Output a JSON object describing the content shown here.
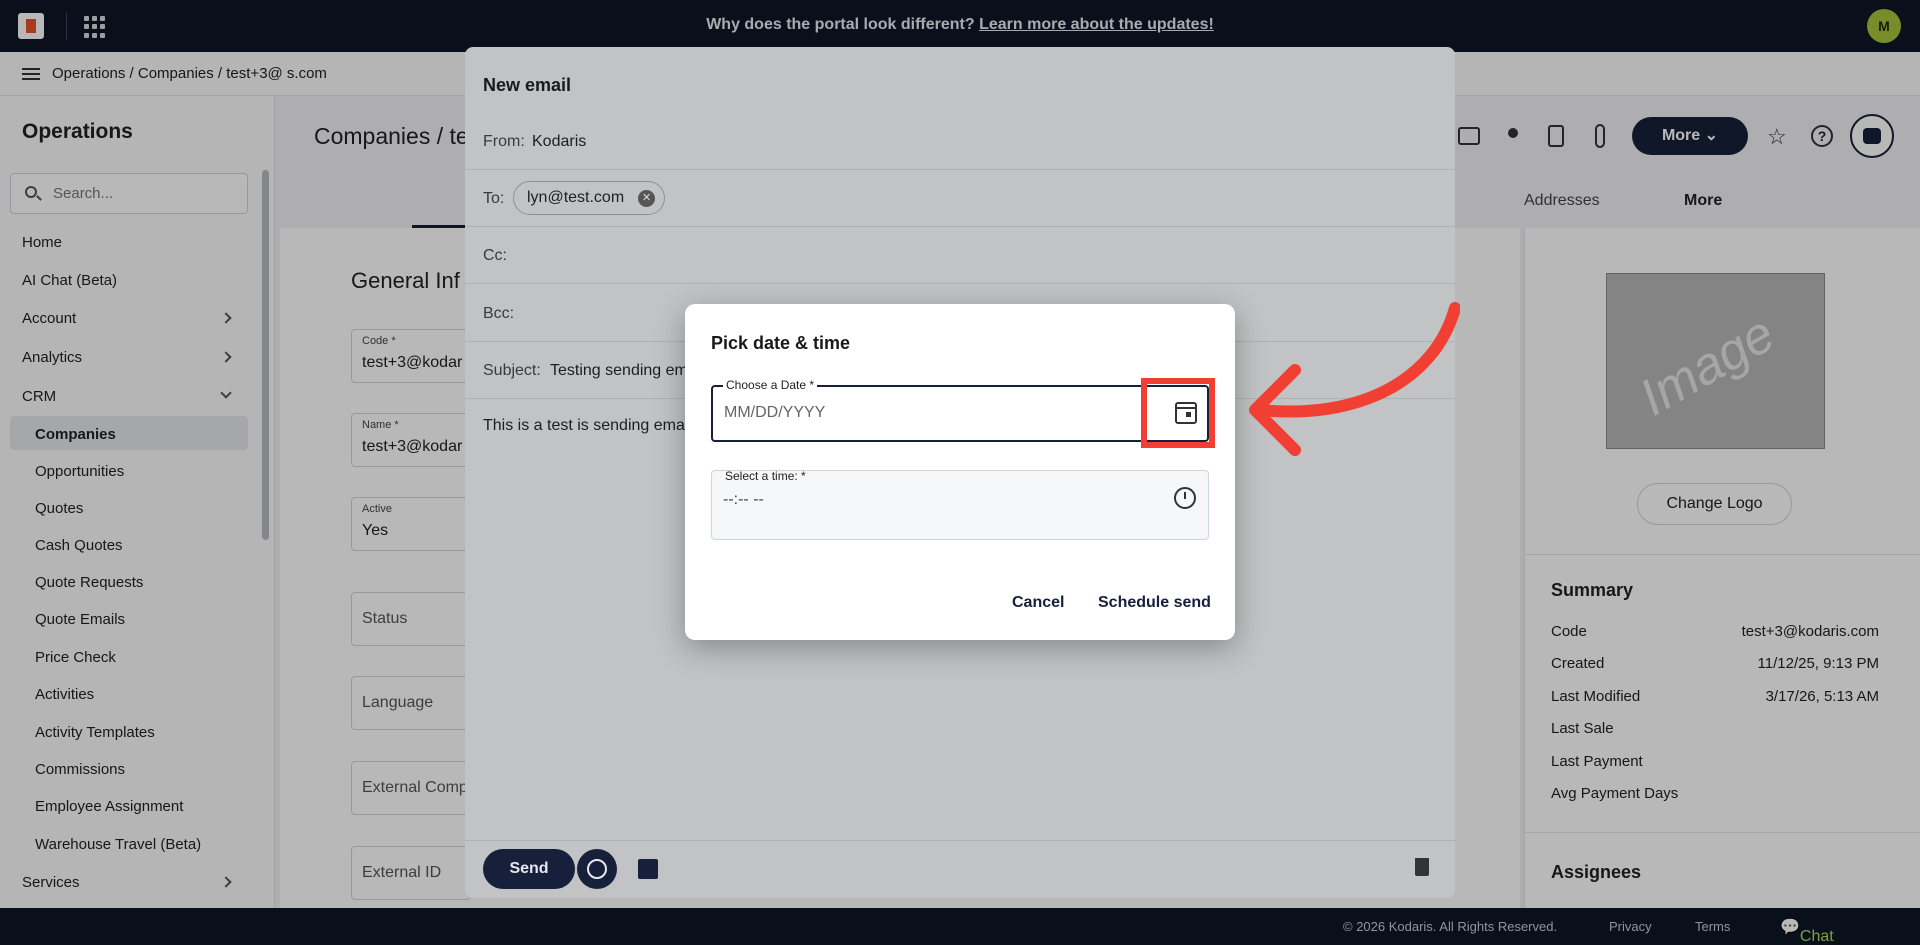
{
  "topbar": {
    "announce_text": "Why does the portal look different?",
    "announce_link": "Learn more about the updates!",
    "avatar_initial": "M"
  },
  "breadcrumb": "Operations / Companies / test+3@        s.com",
  "sidebar": {
    "title": "Operations",
    "search_placeholder": "Search...",
    "items": [
      "Home",
      "AI Chat (Beta)",
      "Account",
      "Analytics",
      "CRM"
    ],
    "crm_items": [
      "Companies",
      "Opportunities",
      "Quotes",
      "Cash Quotes",
      "Quote Requests",
      "Quote Emails",
      "Price Check",
      "Activities",
      "Activity Templates",
      "Commissions",
      "Employee Assignment",
      "Warehouse Travel (Beta)"
    ],
    "services": "Services"
  },
  "main": {
    "title": "Companies / te",
    "section": "General Inf",
    "tabs": [
      "Addresses",
      "More"
    ],
    "fields": [
      {
        "label": "Code *",
        "value": "test+3@kodar"
      },
      {
        "label": "Name *",
        "value": "test+3@kodar"
      },
      {
        "label": "Active",
        "value": "Yes"
      },
      {
        "label": "",
        "value": "Status"
      },
      {
        "label": "",
        "value": "Language"
      },
      {
        "label": "",
        "value": "External Comp"
      },
      {
        "label": "",
        "value": "External ID"
      }
    ]
  },
  "toolbar": {
    "more_label": "More",
    "help_label": "?"
  },
  "right": {
    "image_placeholder": "Image",
    "change_logo": "Change Logo",
    "summary_title": "Summary",
    "summary": [
      {
        "k": "Code",
        "v": "test+3@kodaris.com"
      },
      {
        "k": "Created",
        "v": "11/12/25, 9:13 PM"
      },
      {
        "k": "Last Modified",
        "v": "3/17/26, 5:13 AM"
      },
      {
        "k": "Last Sale",
        "v": ""
      },
      {
        "k": "Last Payment",
        "v": ""
      },
      {
        "k": "Avg Payment Days",
        "v": ""
      }
    ],
    "assignees_title": "Assignees"
  },
  "footer": {
    "copyright": "© 2026 Kodaris. All Rights Reserved.",
    "privacy": "Privacy",
    "terms": "Terms",
    "chat": "Chat with us"
  },
  "email": {
    "title": "New email",
    "from_label": "From:",
    "from_value": "Kodaris",
    "to_label": "To:",
    "to_chip": "lyn@test.com",
    "cc_label": "Cc:",
    "bcc_label": "Bcc:",
    "subject_label": "Subject:",
    "subject_value": "Testing sending em",
    "body": "This is a test is sending ema",
    "send_label": "Send"
  },
  "dialog": {
    "title": "Pick date & time",
    "date_label": "Choose a Date *",
    "date_placeholder": "MM/DD/YYYY",
    "time_label": "Select a time: *",
    "time_placeholder": "--:-- --",
    "cancel": "Cancel",
    "schedule": "Schedule send"
  },
  "colors": {
    "highlight": "#f23f33",
    "navy": "#16203a"
  }
}
